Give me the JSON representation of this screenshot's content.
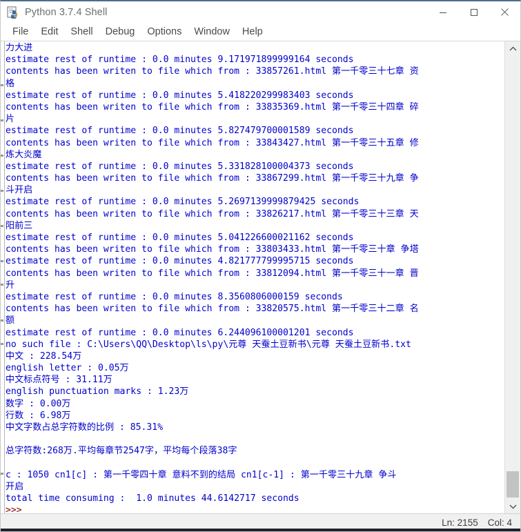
{
  "window": {
    "title": "Python 3.7.4 Shell",
    "icon": "python-idle-icon",
    "controls": {
      "minimize": "minimize-icon",
      "maximize": "maximize-icon",
      "close": "close-icon"
    }
  },
  "menubar": {
    "items": [
      {
        "label": "File"
      },
      {
        "label": "Edit"
      },
      {
        "label": "Shell"
      },
      {
        "label": "Debug"
      },
      {
        "label": "Options"
      },
      {
        "label": "Window"
      },
      {
        "label": "Help"
      }
    ]
  },
  "console": {
    "lines": [
      "力大进",
      "estimate rest of runtime : 0.0 minutes 9.171971899999164 seconds",
      "contents has been writen to file which from : 33857261.html 第一千零三十七章 资",
      "格",
      "estimate rest of runtime : 0.0 minutes 5.418220299983403 seconds",
      "contents has been writen to file which from : 33835369.html 第一千零三十四章 碎",
      "片",
      "estimate rest of runtime : 0.0 minutes 5.827479700001589 seconds",
      "contents has been writen to file which from : 33843427.html 第一千零三十五章 修",
      "炼大炎魔",
      "estimate rest of runtime : 0.0 minutes 5.331828100004373 seconds",
      "contents has been writen to file which from : 33867299.html 第一千零三十九章 争",
      "斗开启",
      "estimate rest of runtime : 0.0 minutes 5.2697139999879425 seconds",
      "contents has been writen to file which from : 33826217.html 第一千零三十三章 天",
      "阳前三",
      "estimate rest of runtime : 0.0 minutes 5.041226600021162 seconds",
      "contents has been writen to file which from : 33803433.html 第一千零三十章 争塔",
      "estimate rest of runtime : 0.0 minutes 4.821777799995715 seconds",
      "contents has been writen to file which from : 33812094.html 第一千零三十一章 晋",
      "升",
      "estimate rest of runtime : 0.0 minutes 8.3560806000159 seconds",
      "contents has been writen to file which from : 33820575.html 第一千零三十二章 名",
      "额",
      "estimate rest of runtime : 0.0 minutes 6.244096100001201 seconds",
      "no such file : C:\\Users\\QQ\\Desktop\\ls\\py\\元尊 天蚕土豆新书\\元尊 天蚕土豆新书.txt",
      "中文 : 228.54万",
      "english letter : 0.05万",
      "中文标点符号 : 31.11万",
      "english punctuation marks : 1.23万",
      "数字 : 0.00万",
      "行数 : 6.98万",
      "中文字数占总字符数的比例 : 85.31%",
      "",
      "总字符数:268万.平均每章节2547字，平均每个段落38字",
      "",
      "c : 1050 cn1[c] : 第一千零四十章 意料不到的结局 cn1[c-1] : 第一千零三十九章 争斗",
      "开启",
      "total time consuming :  1.0 minutes 44.6142717 seconds"
    ],
    "prompt": ">>>"
  },
  "scrollbar": {
    "up_arrow": "chevron-up-icon",
    "down_arrow": "chevron-down-icon"
  },
  "statusbar": {
    "line": "Ln: 2155",
    "column": "Col: 4"
  },
  "colors": {
    "console_text": "#0000cc",
    "prompt": "#880000",
    "title_bar_accent": "#4a6d8c",
    "statusbar_bg": "#f0f0f0"
  }
}
